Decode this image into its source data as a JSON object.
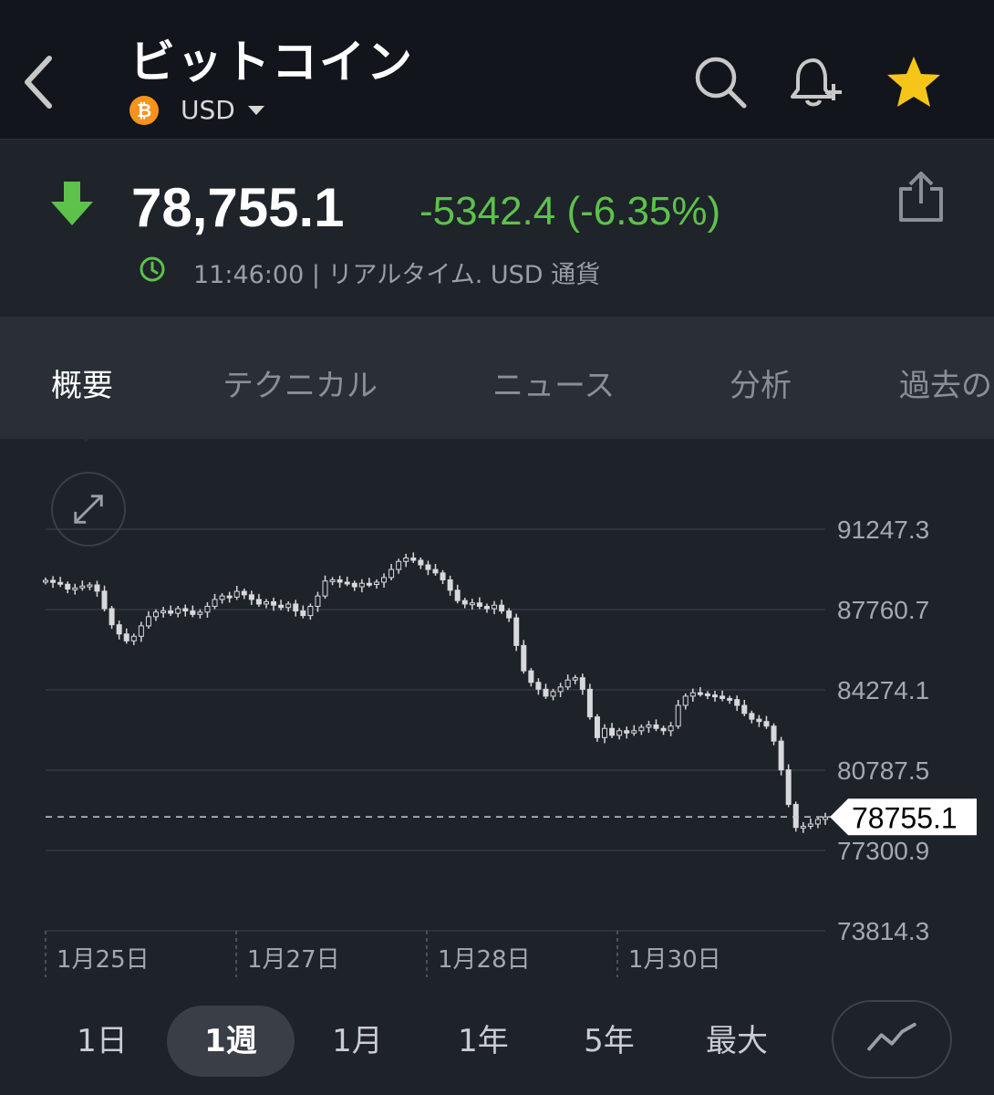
{
  "header": {
    "title": "ビットコイン",
    "currency": "USD",
    "coin_symbol": "₿",
    "icons": [
      "back-chevron-icon",
      "search-icon",
      "bell-plus-icon",
      "star-icon"
    ],
    "star_color": "#f5c518"
  },
  "quote": {
    "price": "78,755.1",
    "change": "-5342.4 (-6.35%)",
    "timestamp": "11:46:00 | リアルタイム. USD 通貨",
    "change_color": "#5cc24a"
  },
  "tabs": [
    {
      "label": "概要",
      "active": true
    },
    {
      "label": "テクニカル",
      "active": false
    },
    {
      "label": "ニュース",
      "active": false
    },
    {
      "label": "分析",
      "active": false
    },
    {
      "label": "過去の",
      "active": false
    }
  ],
  "chart_data": {
    "type": "candlestick",
    "y_ticks": [
      "91247.3",
      "87760.7",
      "84274.1",
      "80787.5",
      "77300.9",
      "73814.3"
    ],
    "x_ticks": [
      "1月25日",
      "1月27日",
      "1月28日",
      "1月30日"
    ],
    "last_price_label": "78755.1",
    "last_price": 78755.1,
    "ylim": [
      73814.3,
      91247.3
    ],
    "grid": true,
    "series": [
      {
        "name": "",
        "values": [
          89030,
          88940,
          88860,
          88650,
          88700,
          88780,
          88830,
          88560,
          87800,
          87100,
          86700,
          86400,
          86600,
          87050,
          87450,
          87650,
          87700,
          87600,
          87800,
          87700,
          87550,
          87650,
          87900,
          88200,
          88350,
          88300,
          88550,
          88400,
          88200,
          88000,
          88100,
          87950,
          87850,
          88000,
          87700,
          87500,
          87900,
          88350,
          89000,
          89050,
          88950,
          88900,
          88750,
          88900,
          88850,
          88950,
          89150,
          89500,
          89850,
          90000,
          89900,
          89700,
          89500,
          89350,
          89050,
          88600,
          88150,
          88000,
          88050,
          87900,
          87800,
          87950,
          87700,
          87400,
          86200,
          85100,
          84600,
          84300,
          84000,
          84200,
          84400,
          84700,
          84800,
          84300,
          83100,
          82200,
          82600,
          82300,
          82500,
          82400,
          82500,
          82650,
          82750,
          82600,
          82500,
          82700,
          83600,
          84000,
          84150,
          84100,
          84050,
          84000,
          83900,
          83850,
          83600,
          83250,
          83000,
          82900,
          82700,
          82050,
          80800,
          79300,
          78300,
          78350,
          78450,
          78650,
          78755
        ]
      }
    ]
  },
  "periods": [
    {
      "label": "1日",
      "active": false
    },
    {
      "label": "1週",
      "active": true
    },
    {
      "label": "1月",
      "active": false
    },
    {
      "label": "1年",
      "active": false
    },
    {
      "label": "5年",
      "active": false
    },
    {
      "label": "最大",
      "active": false
    }
  ]
}
